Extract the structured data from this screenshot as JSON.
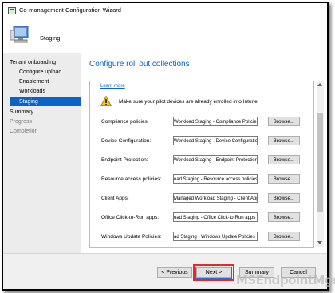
{
  "window": {
    "title": "Co-management Configuration Wizard"
  },
  "header": {
    "title": "Staging"
  },
  "sidebar": {
    "items": [
      {
        "label": "Tenant onboarding",
        "state": "section"
      },
      {
        "label": "Configure upload",
        "state": "sub"
      },
      {
        "label": "Enablement",
        "state": "sub"
      },
      {
        "label": "Workloads",
        "state": "sub"
      },
      {
        "label": "Staging",
        "state": "active"
      },
      {
        "label": "Summary",
        "state": "section"
      },
      {
        "label": "Progress",
        "state": "dim"
      },
      {
        "label": "Completion",
        "state": "dim"
      }
    ]
  },
  "main": {
    "title": "Configure roll out collections",
    "learn_more": "Learn more",
    "warning": "Make sure your pilot devices are already enrolled into Intune.",
    "rows": [
      {
        "label": "Compliance policies:",
        "value": "Workload Staging - Compliance Policies",
        "button": "Browse..."
      },
      {
        "label": "Device Configuration:",
        "value": "Workload Staging - Device Configuration",
        "button": "Browse..."
      },
      {
        "label": "Endpoint Protection:",
        "value": "Workload Staging - Endpoint Protection",
        "button": "Browse..."
      },
      {
        "label": "Resource access policies:",
        "value": "oad Staging - Resource access policies",
        "button": "Browse..."
      },
      {
        "label": "Client Apps:",
        "value": "Managed Workload Staging - Client Apps",
        "button": "Browse..."
      },
      {
        "label": "Office Click-to-Run apps:",
        "value": "oad Staging - Office Click-to-Run apps",
        "button": "Browse..."
      },
      {
        "label": "Windows Update Policies:",
        "value": "ad Staging - Windows Update Policies",
        "button": "Browse..."
      }
    ]
  },
  "footer": {
    "previous": "< Previous",
    "next": "Next >",
    "summary": "Summary",
    "cancel": "Cancel"
  },
  "watermark": "MSEndpointMgr",
  "colors": {
    "accent": "#0a63c7",
    "highlight": "#e22a2a"
  }
}
